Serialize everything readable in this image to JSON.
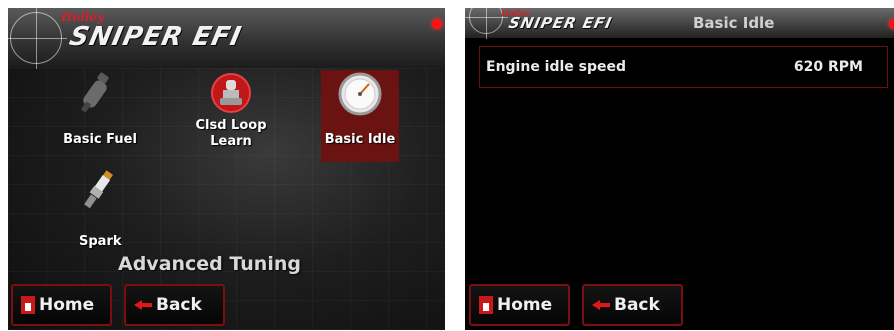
{
  "left_screen": {
    "brand_small": "Holley",
    "brand": "SNIPER EFI",
    "menu": [
      {
        "label": "Basic Fuel",
        "icon": "injector-icon"
      },
      {
        "label": "Clsd Loop Learn",
        "icon": "o2-sensor-icon"
      },
      {
        "label": "Basic Idle",
        "icon": "gauge-icon",
        "selected": true
      },
      {
        "label": "Spark",
        "icon": "spark-plug-icon"
      }
    ],
    "clsd_line1": "Clsd Loop",
    "clsd_line2": "Learn",
    "section_title": "Advanced Tuning",
    "home_label": "Home",
    "back_label": "Back"
  },
  "right_screen": {
    "brand_small": "Holley",
    "brand": "SNIPER EFI",
    "title": "Basic Idle",
    "setting": {
      "label": "Engine idle speed",
      "value": "620 RPM"
    },
    "home_label": "Home",
    "back_label": "Back"
  },
  "colors": {
    "accent": "#7a0f0f",
    "indicator": "#ff1010",
    "selected_tile": "#6b1313"
  }
}
